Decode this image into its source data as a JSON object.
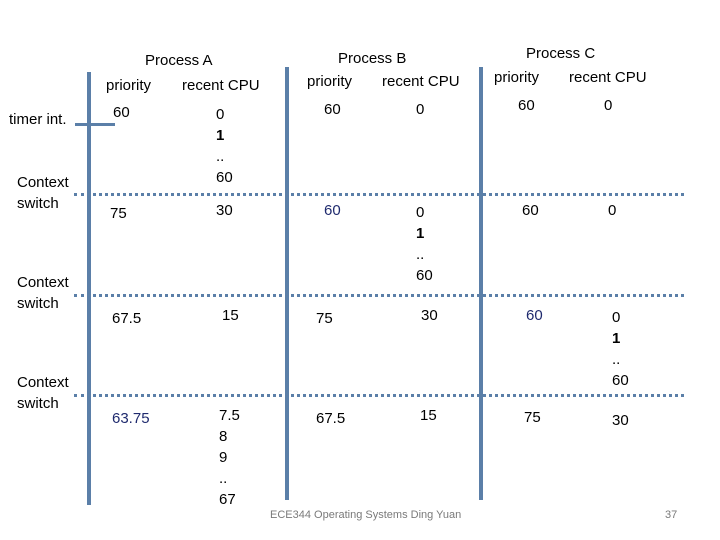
{
  "row_labels": {
    "timer": "timer int.",
    "cs1": [
      "Context",
      "switch"
    ],
    "cs2": [
      "Context",
      "switch"
    ],
    "cs3": [
      "Context",
      "switch"
    ]
  },
  "processes": [
    {
      "name": "Process A",
      "col_priority": "priority",
      "col_cpu": "recent CPU",
      "rows": [
        {
          "priority": "60",
          "cpu": [
            "0",
            "1",
            "..",
            "60"
          ]
        },
        {
          "priority": "75",
          "cpu": [
            "30"
          ]
        },
        {
          "priority": "67.5",
          "cpu": [
            "15"
          ]
        },
        {
          "priority": "63.75",
          "cpu": [
            "7.5",
            "8",
            "9",
            "..",
            "67"
          ]
        }
      ]
    },
    {
      "name": "Process B",
      "col_priority": "priority",
      "col_cpu": "recent CPU",
      "rows": [
        {
          "priority": "60",
          "cpu": [
            "0"
          ]
        },
        {
          "priority": "60",
          "cpu": [
            "0",
            "1",
            "..",
            "60"
          ]
        },
        {
          "priority": "75",
          "cpu": [
            "30"
          ]
        },
        {
          "priority": "67.5",
          "cpu": [
            "15"
          ]
        }
      ]
    },
    {
      "name": "Process C",
      "col_priority": "priority",
      "col_cpu": "recent CPU",
      "rows": [
        {
          "priority": "60",
          "cpu": [
            "0"
          ]
        },
        {
          "priority": "60",
          "cpu": [
            "0"
          ]
        },
        {
          "priority": "60",
          "cpu": [
            "0",
            "1",
            "..",
            "60"
          ]
        },
        {
          "priority": "75",
          "cpu": [
            "30"
          ]
        }
      ]
    }
  ],
  "footer": {
    "course": "ECE344 Operating Systems Ding Yuan",
    "page_number": "37"
  },
  "colors": {
    "line": "#5b7fa8",
    "running_priority_text": "#1f2a6e"
  }
}
